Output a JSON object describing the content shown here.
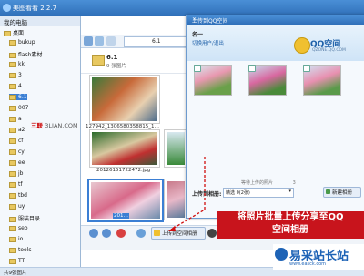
{
  "window": {
    "title": "美图看看 2.2.7"
  },
  "tree": {
    "header": "我的电脑",
    "items": [
      {
        "label": "桌面",
        "selected": false
      },
      {
        "label": "bukup",
        "selected": false
      },
      {
        "label": "flash素材",
        "selected": false
      },
      {
        "label": "kk",
        "selected": false
      },
      {
        "label": "3",
        "selected": false
      },
      {
        "label": "4",
        "selected": false
      },
      {
        "label": "6.1",
        "selected": true
      },
      {
        "label": "007",
        "selected": false
      },
      {
        "label": "a",
        "selected": false
      },
      {
        "label": "a2",
        "selected": false
      },
      {
        "label": "cf",
        "selected": false
      },
      {
        "label": "cy",
        "selected": false
      },
      {
        "label": "ee",
        "selected": false
      },
      {
        "label": "jb",
        "selected": false
      },
      {
        "label": "tf",
        "selected": false
      },
      {
        "label": "tbd",
        "selected": false
      },
      {
        "label": "uy",
        "selected": false
      },
      {
        "label": "服装目录",
        "selected": false
      },
      {
        "label": "seo",
        "selected": false
      },
      {
        "label": "io",
        "selected": false
      },
      {
        "label": "tools",
        "selected": false
      },
      {
        "label": "TT",
        "selected": false
      }
    ]
  },
  "watermark": {
    "brand": "三联",
    "site": "3LIAN.COM"
  },
  "browser": {
    "address": "6.1",
    "folder_name": "6.1",
    "folder_count": "9 张图片",
    "captions": [
      "127942_1306580358815_1…",
      "20126151722472.jpg",
      "201…",
      "2012"
    ]
  },
  "bottom": {
    "upload_btn": "上传到空间相册"
  },
  "status": {
    "text": "共9张图片"
  },
  "dialog": {
    "title": "上传到QQ空间",
    "user": "名一",
    "change_user": "切换用户/退出",
    "brand": "QQ空间",
    "brand_sub": "QZONE.QQ.COM",
    "pending_label": "等待上传的照片",
    "pending_count": "3",
    "album_label": "上传到相册:",
    "album_value": "精选 0(2张)",
    "new_album_btn": "新建相册"
  },
  "annotation": {
    "line1": "将照片批量上传分享至QQ",
    "line2": "空间相册"
  },
  "site_brand": {
    "name": "易采站长站",
    "url": "www.easck.com"
  },
  "colors": {
    "accent": "#2f6fb8",
    "annotation": "#c8141c"
  }
}
